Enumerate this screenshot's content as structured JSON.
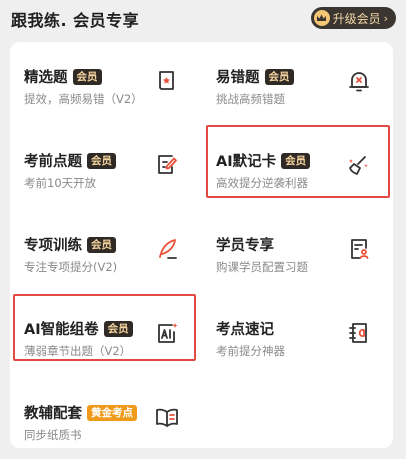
{
  "header": {
    "title": "跟我练. 会员专享",
    "upgrade_label": "升级会员",
    "upgrade_icon": "crown-icon"
  },
  "colors": {
    "badge_bg": "#2f2a25",
    "badge_text": "#f3d29d",
    "gold_badge_bg": "#f09a1c",
    "icon_accent": "#e8503a",
    "highlight_border": "#e14a44"
  },
  "items": [
    {
      "title": "精选题",
      "badge": "会员",
      "subtitle": "提效，高频易错（V2）",
      "icon": "scroll-star-icon"
    },
    {
      "title": "易错题",
      "badge": "会员",
      "subtitle": "挑战高频错题",
      "icon": "bell-x-icon"
    },
    {
      "title": "考前点题",
      "badge": "会员",
      "subtitle": "考前10天开放",
      "icon": "edit-document-icon"
    },
    {
      "title": "AI默记卡",
      "badge": "会员",
      "subtitle": "高效提分逆袭利器",
      "icon": "broom-sparkle-icon"
    },
    {
      "title": "专项训练",
      "badge": "会员",
      "subtitle": "专注专项提分(V2)",
      "icon": "quill-pen-icon"
    },
    {
      "title": "学员专享",
      "badge": "",
      "subtitle": "购课学员配置习题",
      "icon": "member-id-card-icon"
    },
    {
      "title": "AI智能组卷",
      "badge": "会员",
      "subtitle": "薄弱章节出题（V2）",
      "icon": "ai-sparkle-icon"
    },
    {
      "title": "考点速记",
      "badge": "",
      "subtitle": "考前提分神器",
      "icon": "notebook-icon"
    },
    {
      "title": "教辅配套",
      "badge": "黄金考点",
      "subtitle": "同步纸质书",
      "icon": "open-book-icon"
    }
  ]
}
